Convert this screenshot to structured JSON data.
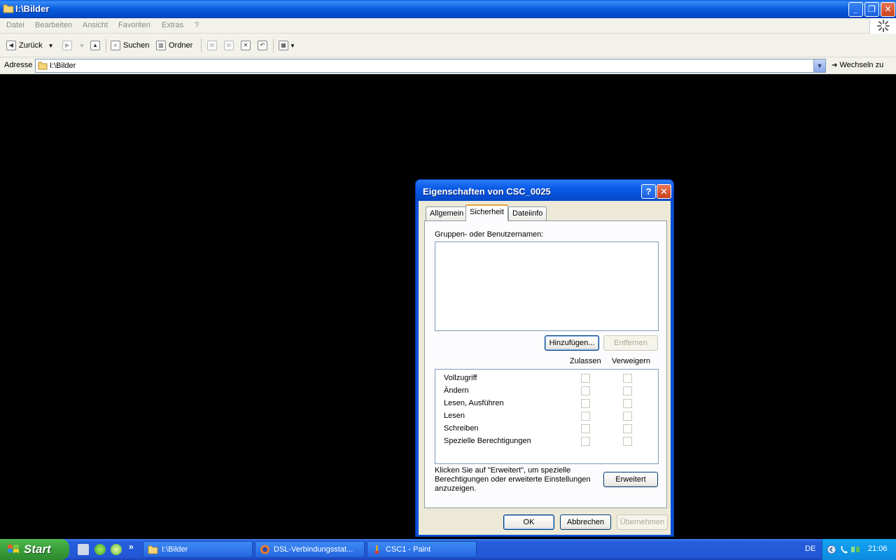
{
  "window": {
    "title": "I:\\Bilder",
    "controls": {
      "minimize": "_",
      "restore": "❐",
      "close": "✕"
    }
  },
  "menubar": {
    "items": [
      "Datei",
      "Bearbeiten",
      "Ansicht",
      "Favoriten",
      "Extras",
      "?"
    ]
  },
  "toolbar": {
    "back_label": "Zurück",
    "search_label": "Suchen",
    "folders_label": "Ordner"
  },
  "addressbar": {
    "label": "Adresse",
    "value": "I:\\Bilder",
    "go_label": "Wechseln zu"
  },
  "dialog": {
    "title": "Eigenschaften von CSC_0025",
    "help_glyph": "?",
    "close_glyph": "✕",
    "tabs": [
      {
        "label": "Allgemein",
        "active": false
      },
      {
        "label": "Sicherheit",
        "active": true
      },
      {
        "label": "Dateiinfo",
        "active": false
      }
    ],
    "groups_label": "Gruppen- oder Benutzernamen:",
    "add_button": "Hinzufügen...",
    "remove_button": "Entfernen",
    "columns": {
      "allow": "Zulassen",
      "deny": "Verweigern"
    },
    "permissions": [
      "Vollzugriff",
      "Ändern",
      "Lesen, Ausführen",
      "Lesen",
      "Schreiben",
      "Spezielle Berechtigungen"
    ],
    "advanced_text": "Klicken Sie auf \"Erweitert\", um spezielle Berechtigungen oder erweiterte Einstellungen anzuzeigen.",
    "advanced_button": "Erweitert",
    "ok_button": "OK",
    "cancel_button": "Abbrechen",
    "apply_button": "Übernehmen"
  },
  "taskbar": {
    "start_label": "Start",
    "quicklaunch_more": "»",
    "tasks": [
      "I:\\Bilder",
      "DSL-Verbindungsstat...",
      "CSC1 - Paint"
    ],
    "language": "DE",
    "clock": "21:06"
  },
  "colors": {
    "xp_blue": "#0a5fe0",
    "start_green": "#3a9e3a",
    "tab_highlight": "#e8a33a",
    "dialog_bg": "#ece9d8"
  }
}
